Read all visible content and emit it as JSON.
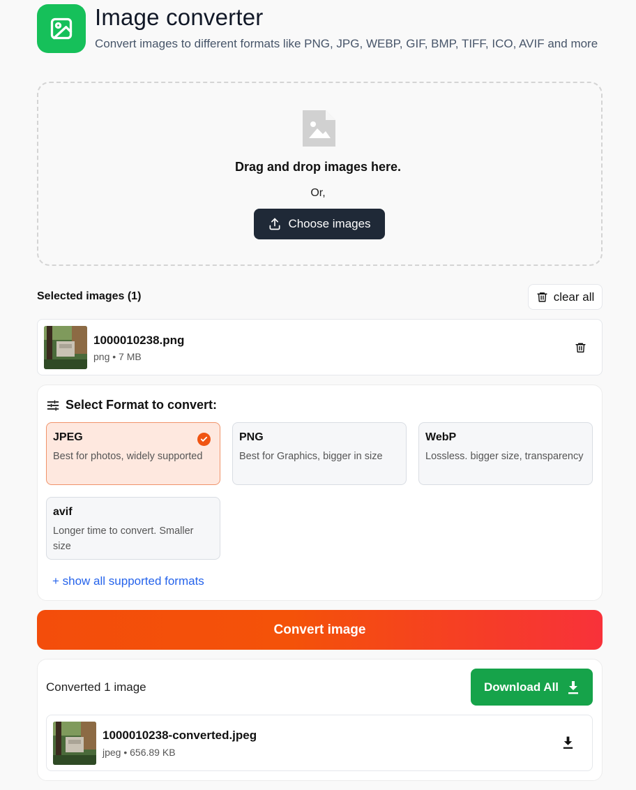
{
  "header": {
    "title": "Image converter",
    "subtitle": "Convert images to different formats like PNG, JPG, WEBP, GIF, BMP, TIFF, ICO, AVIF and more",
    "logo_icon": "image-icon",
    "logo_color": "#16c05a"
  },
  "dropzone": {
    "icon": "image-placeholder-icon",
    "heading": "Drag and drop images here.",
    "or_text": "Or,",
    "button_label": "Choose images",
    "button_icon": "upload-icon"
  },
  "selected": {
    "heading": "Selected images (1)",
    "clear_label": "clear all",
    "clear_icon": "trash-icon",
    "files": [
      {
        "name": "1000010238.png",
        "meta": "png • 7 MB",
        "remove_icon": "trash-icon"
      }
    ]
  },
  "formats": {
    "heading": "Select Format to convert:",
    "heading_icon": "sliders-icon",
    "options": [
      {
        "name": "JPEG",
        "desc": "Best for photos, widely supported",
        "selected": true
      },
      {
        "name": "PNG",
        "desc": "Best for Graphics, bigger in size",
        "selected": false
      },
      {
        "name": "WebP",
        "desc": "Lossless. bigger size, transparency",
        "selected": false
      },
      {
        "name": "avif",
        "desc": "Longer time to convert. Smaller size",
        "selected": false
      }
    ],
    "show_all_label": "+ show all supported formats",
    "accent_color": "#f05412"
  },
  "convert": {
    "button_label": "Convert image"
  },
  "results": {
    "count_label": "Converted 1 image",
    "download_all_label": "Download All",
    "download_icon": "download-icon",
    "download_color": "#16a34a",
    "files": [
      {
        "name": "1000010238-converted.jpeg",
        "meta": "jpeg • 656.89 KB",
        "download_icon": "download-icon"
      }
    ]
  }
}
